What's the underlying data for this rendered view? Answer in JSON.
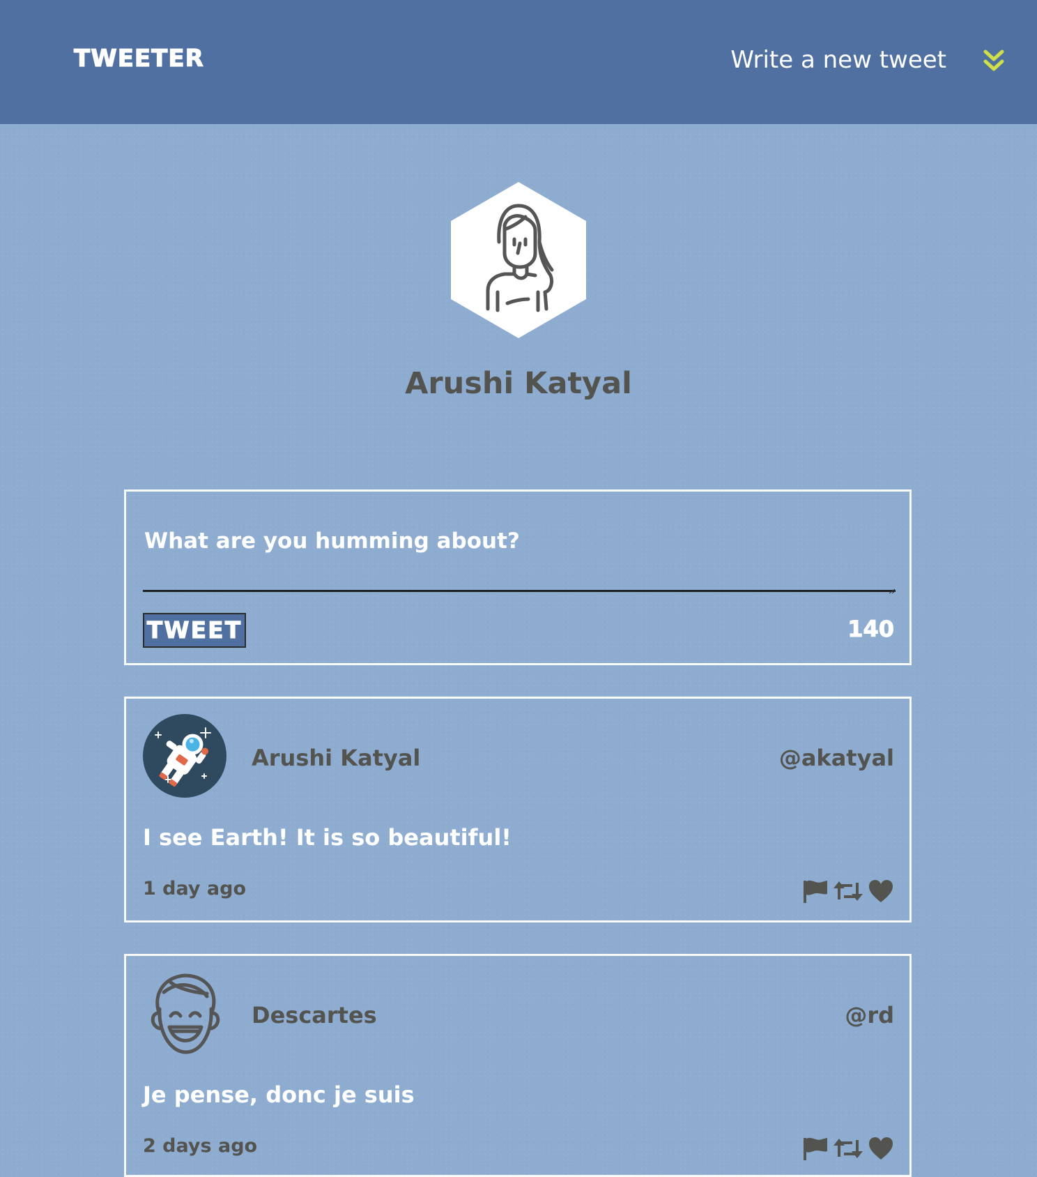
{
  "nav": {
    "brand": "TWEETER",
    "compose_link": "Write a new tweet",
    "toggle_icon": "double-chevron-down-icon",
    "accent_color": "#cfe04a",
    "background_color": "#4f70a0"
  },
  "profile": {
    "name": "Arushi Katyal",
    "avatar_icon": "woman-avatar-icon"
  },
  "compose": {
    "placeholder": "What are you humming about?",
    "value": "",
    "button_label": "TWEET",
    "counter": "140"
  },
  "tweets": [
    {
      "avatar_icon": "astronaut-avatar-icon",
      "name": "Arushi Katyal",
      "handle": "@akatyal",
      "text": "I see Earth! It is so beautiful!",
      "timestamp": "1 day ago",
      "actions": [
        "flag-icon",
        "retweet-icon",
        "heart-icon"
      ]
    },
    {
      "avatar_icon": "smiling-man-avatar-icon",
      "name": "Descartes",
      "handle": "@rd",
      "text": "Je pense, donc je suis",
      "timestamp": "2 days ago",
      "actions": [
        "flag-icon",
        "retweet-icon",
        "heart-icon"
      ]
    }
  ],
  "colors": {
    "page_background": "#8eacd0",
    "card_border": "#f7f9fb",
    "muted_text": "#53544f",
    "astronaut_background": "#2f4a5f"
  }
}
